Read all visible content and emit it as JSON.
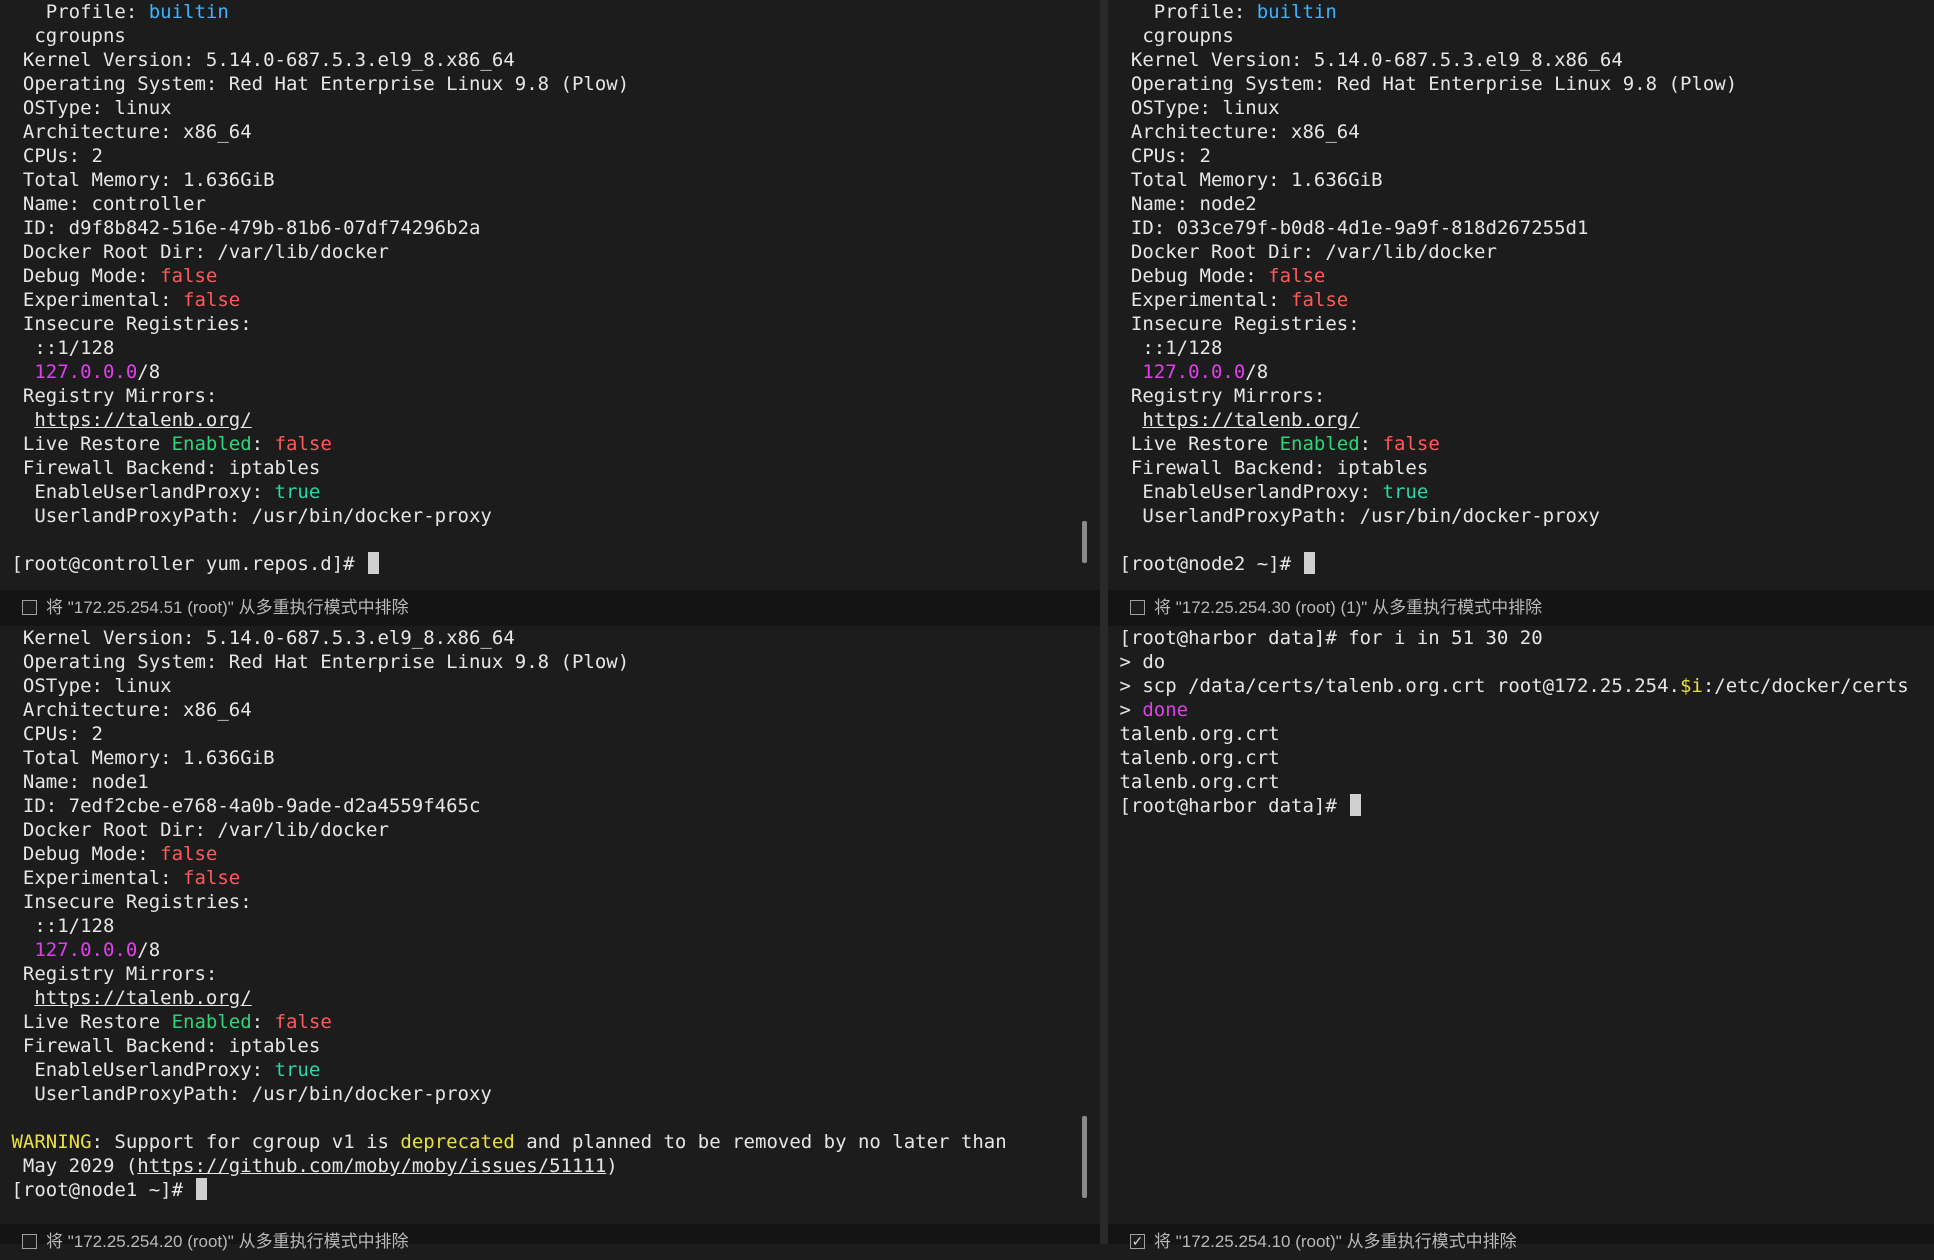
{
  "panes": [
    {
      "id": "controller",
      "lines": [
        [
          {
            "t": "    Profile: "
          },
          {
            "t": "builtin",
            "c": "c-blue"
          }
        ],
        [
          {
            "t": "   cgroupns"
          }
        ],
        [
          {
            "t": "  Kernel Version: 5.14.0-687.5.3.el9_8.x86_64"
          }
        ],
        [
          {
            "t": "  Operating System: Red Hat Enterprise Linux 9.8 (Plow)"
          }
        ],
        [
          {
            "t": "  OSType: linux"
          }
        ],
        [
          {
            "t": "  Architecture: x86_64"
          }
        ],
        [
          {
            "t": "  CPUs: 2"
          }
        ],
        [
          {
            "t": "  Total Memory: 1.636GiB"
          }
        ],
        [
          {
            "t": "  Name: controller"
          }
        ],
        [
          {
            "t": "  ID: d9f8b842-516e-479b-81b6-07df74296b2a"
          }
        ],
        [
          {
            "t": "  Docker Root Dir: /var/lib/docker"
          }
        ],
        [
          {
            "t": "  Debug Mode: "
          },
          {
            "t": "false",
            "c": "c-red"
          }
        ],
        [
          {
            "t": "  Experimental: "
          },
          {
            "t": "false",
            "c": "c-red"
          }
        ],
        [
          {
            "t": "  Insecure Registries:"
          }
        ],
        [
          {
            "t": "   ::1/128"
          }
        ],
        [
          {
            "t": "   "
          },
          {
            "t": "127.0.0.0",
            "c": "c-magenta"
          },
          {
            "t": "/8"
          }
        ],
        [
          {
            "t": "  Registry Mirrors:"
          }
        ],
        [
          {
            "t": "   "
          },
          {
            "t": "https://talenb.org/",
            "c": "u"
          }
        ],
        [
          {
            "t": "  Live Restore "
          },
          {
            "t": "Enabled",
            "c": "c-green"
          },
          {
            "t": ": "
          },
          {
            "t": "false",
            "c": "c-red"
          }
        ],
        [
          {
            "t": "  Firewall Backend: iptables"
          }
        ],
        [
          {
            "t": "   EnableUserlandProxy: "
          },
          {
            "t": "true",
            "c": "c-teal"
          }
        ],
        [
          {
            "t": "   UserlandProxyPath: /usr/bin/docker-proxy"
          }
        ],
        [
          {
            "t": ""
          }
        ],
        [
          {
            "t": " [root@controller yum.repos.d]# "
          },
          {
            "cursor": true
          }
        ]
      ],
      "footer_label": "将 \"172.25.254.51 (root)\" 从多重执行模式中排除",
      "footer_checked": false
    },
    {
      "id": "node2",
      "lines": [
        [
          {
            "t": "    Profile: "
          },
          {
            "t": "builtin",
            "c": "c-blue"
          }
        ],
        [
          {
            "t": "   cgroupns"
          }
        ],
        [
          {
            "t": "  Kernel Version: 5.14.0-687.5.3.el9_8.x86_64"
          }
        ],
        [
          {
            "t": "  Operating System: Red Hat Enterprise Linux 9.8 (Plow)"
          }
        ],
        [
          {
            "t": "  OSType: linux"
          }
        ],
        [
          {
            "t": "  Architecture: x86_64"
          }
        ],
        [
          {
            "t": "  CPUs: 2"
          }
        ],
        [
          {
            "t": "  Total Memory: 1.636GiB"
          }
        ],
        [
          {
            "t": "  Name: node2"
          }
        ],
        [
          {
            "t": "  ID: 033ce79f-b0d8-4d1e-9a9f-818d267255d1"
          }
        ],
        [
          {
            "t": "  Docker Root Dir: /var/lib/docker"
          }
        ],
        [
          {
            "t": "  Debug Mode: "
          },
          {
            "t": "false",
            "c": "c-red"
          }
        ],
        [
          {
            "t": "  Experimental: "
          },
          {
            "t": "false",
            "c": "c-red"
          }
        ],
        [
          {
            "t": "  Insecure Registries:"
          }
        ],
        [
          {
            "t": "   ::1/128"
          }
        ],
        [
          {
            "t": "   "
          },
          {
            "t": "127.0.0.0",
            "c": "c-magenta"
          },
          {
            "t": "/8"
          }
        ],
        [
          {
            "t": "  Registry Mirrors:"
          }
        ],
        [
          {
            "t": "   "
          },
          {
            "t": "https://talenb.org/",
            "c": "u"
          }
        ],
        [
          {
            "t": "  Live Restore "
          },
          {
            "t": "Enabled",
            "c": "c-green"
          },
          {
            "t": ": "
          },
          {
            "t": "false",
            "c": "c-red"
          }
        ],
        [
          {
            "t": "  Firewall Backend: iptables"
          }
        ],
        [
          {
            "t": "   EnableUserlandProxy: "
          },
          {
            "t": "true",
            "c": "c-teal"
          }
        ],
        [
          {
            "t": "   UserlandProxyPath: /usr/bin/docker-proxy"
          }
        ],
        [
          {
            "t": ""
          }
        ],
        [
          {
            "t": " [root@node2 ~]# "
          },
          {
            "cursor": true
          }
        ]
      ],
      "footer_label": "将 \"172.25.254.30 (root) (1)\" 从多重执行模式中排除",
      "footer_checked": false
    },
    {
      "id": "node1",
      "lines": [
        [
          {
            "t": "  Kernel Version: 5.14.0-687.5.3.el9_8.x86_64"
          }
        ],
        [
          {
            "t": "  Operating System: Red Hat Enterprise Linux 9.8 (Plow)"
          }
        ],
        [
          {
            "t": "  OSType: linux"
          }
        ],
        [
          {
            "t": "  Architecture: x86_64"
          }
        ],
        [
          {
            "t": "  CPUs: 2"
          }
        ],
        [
          {
            "t": "  Total Memory: 1.636GiB"
          }
        ],
        [
          {
            "t": "  Name: node1"
          }
        ],
        [
          {
            "t": "  ID: 7edf2cbe-e768-4a0b-9ade-d2a4559f465c"
          }
        ],
        [
          {
            "t": "  Docker Root Dir: /var/lib/docker"
          }
        ],
        [
          {
            "t": "  Debug Mode: "
          },
          {
            "t": "false",
            "c": "c-red"
          }
        ],
        [
          {
            "t": "  Experimental: "
          },
          {
            "t": "false",
            "c": "c-red"
          }
        ],
        [
          {
            "t": "  Insecure Registries:"
          }
        ],
        [
          {
            "t": "   ::1/128"
          }
        ],
        [
          {
            "t": "   "
          },
          {
            "t": "127.0.0.0",
            "c": "c-magenta"
          },
          {
            "t": "/8"
          }
        ],
        [
          {
            "t": "  Registry Mirrors:"
          }
        ],
        [
          {
            "t": "   "
          },
          {
            "t": "https://talenb.org/",
            "c": "u"
          }
        ],
        [
          {
            "t": "  Live Restore "
          },
          {
            "t": "Enabled",
            "c": "c-green"
          },
          {
            "t": ": "
          },
          {
            "t": "false",
            "c": "c-red"
          }
        ],
        [
          {
            "t": "  Firewall Backend: iptables"
          }
        ],
        [
          {
            "t": "   EnableUserlandProxy: "
          },
          {
            "t": "true",
            "c": "c-teal"
          }
        ],
        [
          {
            "t": "   UserlandProxyPath: /usr/bin/docker-proxy"
          }
        ],
        [
          {
            "t": ""
          }
        ],
        [
          {
            "t": " "
          },
          {
            "t": "WARNING",
            "c": "c-yellow"
          },
          {
            "t": ": Support for cgroup v1 is "
          },
          {
            "t": "deprecated",
            "c": "c-yellow"
          },
          {
            "t": " and planned to be removed by no later than"
          }
        ],
        [
          {
            "t": "  May 2029 ("
          },
          {
            "t": "https://github.com/moby/moby/issues/51111",
            "c": "u"
          },
          {
            "t": ")"
          }
        ],
        [
          {
            "t": " [root@node1 ~]# "
          },
          {
            "cursor": true
          }
        ]
      ],
      "footer_label": "将 \"172.25.254.20 (root)\" 从多重执行模式中排除",
      "footer_checked": false
    },
    {
      "id": "harbor",
      "lines": [
        [
          {
            "t": " [root@harbor data]# for i in 51 30 20"
          }
        ],
        [
          {
            "t": " > do"
          }
        ],
        [
          {
            "t": " > scp /data/certs/talenb.org.crt root@172.25.254."
          },
          {
            "t": "$i",
            "c": "c-yellow"
          },
          {
            "t": ":/etc/docker/certs"
          }
        ],
        [
          {
            "t": " > "
          },
          {
            "t": "done",
            "c": "c-magenta"
          }
        ],
        [
          {
            "t": " talenb.org.crt"
          }
        ],
        [
          {
            "t": " talenb.org.crt"
          }
        ],
        [
          {
            "t": " talenb.org.crt"
          }
        ],
        [
          {
            "t": " [root@harbor data]# "
          },
          {
            "cursor": true
          }
        ]
      ],
      "footer_label": "将 \"172.25.254.10 (root)\" 从多重执行模式中排除",
      "footer_checked": true
    }
  ]
}
